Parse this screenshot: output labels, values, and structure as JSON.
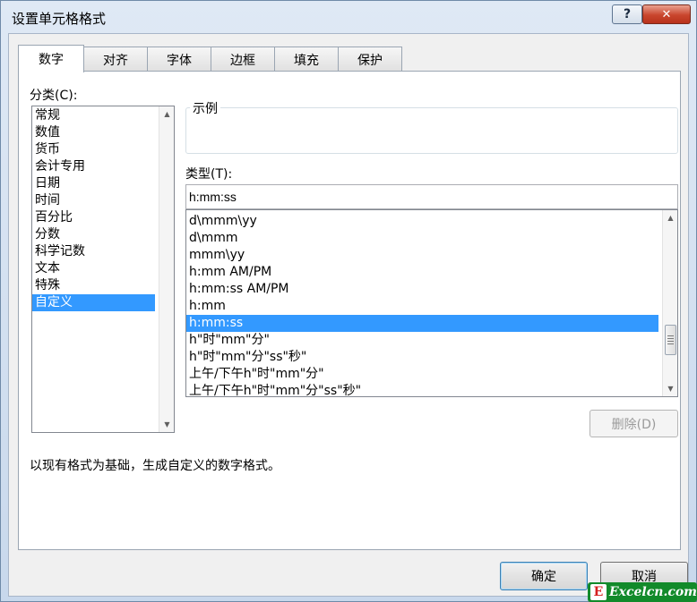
{
  "window": {
    "title": "设置单元格格式",
    "help_label": "?",
    "close_label": "✕"
  },
  "tabs": [
    {
      "label": "数字"
    },
    {
      "label": "对齐"
    },
    {
      "label": "字体"
    },
    {
      "label": "边框"
    },
    {
      "label": "填充"
    },
    {
      "label": "保护"
    }
  ],
  "category": {
    "label": "分类(C):",
    "items": [
      "常规",
      "数值",
      "货币",
      "会计专用",
      "日期",
      "时间",
      "百分比",
      "分数",
      "科学记数",
      "文本",
      "特殊",
      "自定义"
    ],
    "selected": "自定义"
  },
  "sample": {
    "label": "示例",
    "value": ""
  },
  "type": {
    "label": "类型(T):",
    "value": "h:mm:ss",
    "items": [
      "d\\mmm\\yy",
      "d\\mmm",
      "mmm\\yy",
      "h:mm AM/PM",
      "h:mm:ss AM/PM",
      "h:mm",
      "h:mm:ss",
      "h\"时\"mm\"分\"",
      "h\"时\"mm\"分\"ss\"秒\"",
      "上午/下午h\"时\"mm\"分\"",
      "上午/下午h\"时\"mm\"分\"ss\"秒\""
    ],
    "selected": "h:mm:ss"
  },
  "delete_label": "删除(D)",
  "description": "以现有格式为基础，生成自定义的数字格式。",
  "ok_label": "确定",
  "cancel_label": "取消",
  "watermark": {
    "badge": "E",
    "text": "Excelcn.com"
  },
  "icons": {
    "scroll_up": "triangle-up",
    "scroll_down": "triangle-down"
  },
  "colors": {
    "selection": "#3399ff",
    "close": "#c9452d"
  }
}
